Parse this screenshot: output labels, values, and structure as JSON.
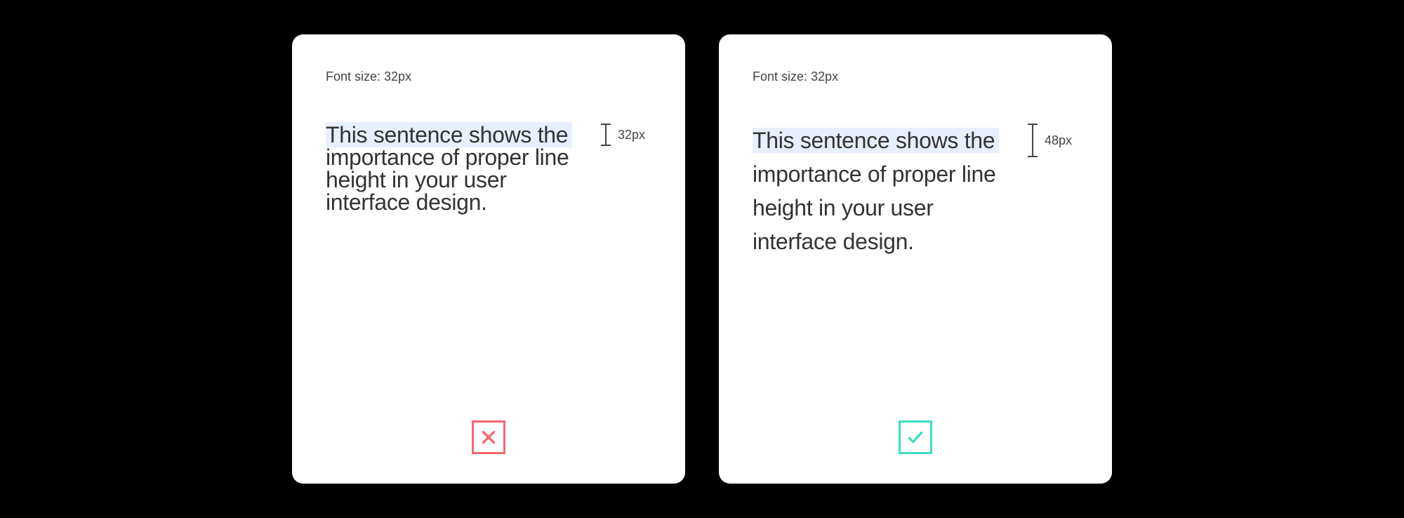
{
  "panels": {
    "bad": {
      "caption": "Font size: 32px",
      "text_highlight": "This sentence shows the",
      "text_rest": " importance of proper line height in your user interface design.",
      "measure_label": "32px"
    },
    "good": {
      "caption": "Font size: 32px",
      "text_highlight": "This sentence shows the",
      "text_rest": " importance of proper line height in your user interface design.",
      "measure_label": "48px"
    }
  }
}
